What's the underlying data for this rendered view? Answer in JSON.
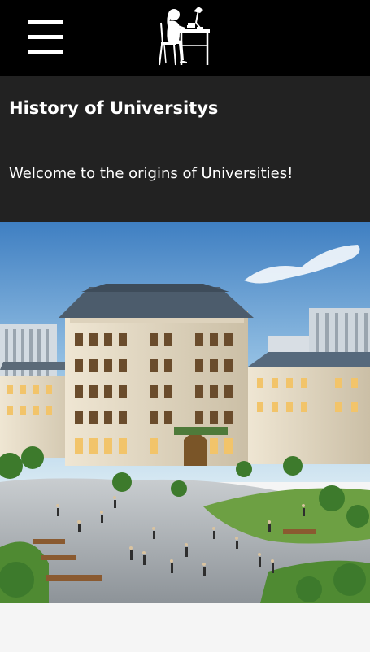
{
  "header": {
    "menu_icon": "hamburger-menu-icon",
    "logo_icon": "student-at-desk-logo"
  },
  "hero": {
    "title": "History of Universitys",
    "welcome": "Welcome to the origins of Universities!"
  },
  "image": {
    "subject": "campus-illustration"
  },
  "colors": {
    "topbar": "#000000",
    "hero_bg": "#222222",
    "text": "#ffffff",
    "page_bg": "#f5f5f5"
  }
}
